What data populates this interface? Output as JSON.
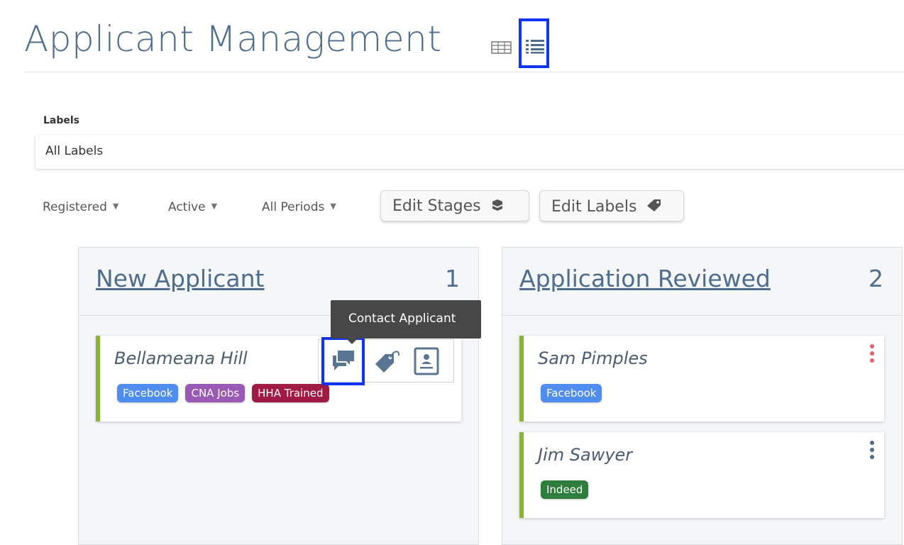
{
  "header": {
    "title": "Applicant Management",
    "views": [
      {
        "icon": "table-view-icon",
        "active": false
      },
      {
        "icon": "list-view-icon",
        "active": true
      }
    ]
  },
  "labels_filter": {
    "caption": "Labels",
    "selected": "All Labels"
  },
  "filters": {
    "registration": "Registered",
    "status": "Active",
    "period": "All Periods"
  },
  "toolbar": {
    "edit_stages": "Edit Stages",
    "edit_labels": "Edit Labels"
  },
  "columns": [
    {
      "title": "New Applicant",
      "count": "1",
      "cards": [
        {
          "name": "Bellameana Hill",
          "tags": [
            {
              "label": "Facebook",
              "color": "#4f8ef0"
            },
            {
              "label": "CNA Jobs",
              "color": "#9b59b6"
            },
            {
              "label": "HHA Trained",
              "color": "#a01a44"
            }
          ]
        }
      ]
    },
    {
      "title": "Application Reviewed",
      "count": "2",
      "cards": [
        {
          "name": "Sam Pimples",
          "menu_color": "#e8626b",
          "tags": [
            {
              "label": "Facebook",
              "color": "#4f8ef0"
            }
          ]
        },
        {
          "name": "Jim Sawyer",
          "menu_color": "#4f6d8f",
          "tags": [
            {
              "label": "Indeed",
              "color": "#2e7d3c"
            }
          ]
        }
      ]
    }
  ],
  "card_actions": {
    "tooltip": "Contact Applicant",
    "icons": [
      "contact-chat-icon",
      "tag-icon",
      "profile-card-icon"
    ]
  },
  "colors": {
    "accent": "#4f6d8f",
    "card_border": "#8ab33a",
    "highlight": "#1034f0"
  }
}
